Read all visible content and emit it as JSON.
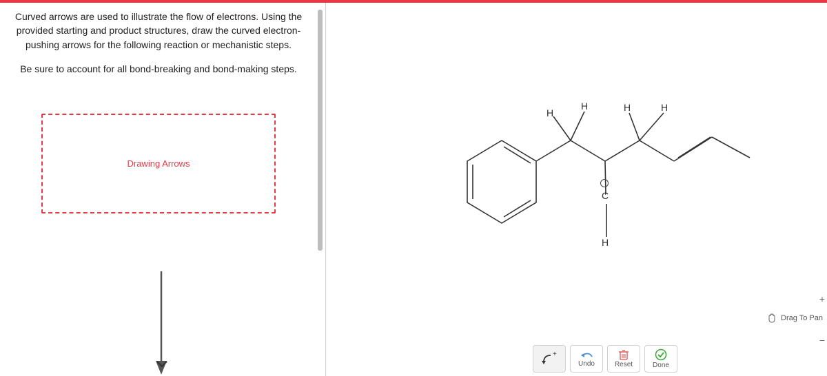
{
  "instructions": {
    "paragraph1": "Curved arrows are used to illustrate the flow of electrons. Using the provided starting and product structures, draw the curved electron-pushing arrows for the following reaction or mechanistic steps.",
    "paragraph2": "Be sure to account for all bond-breaking and bond-making steps."
  },
  "drawing_box_label": "Drawing Arrows",
  "molecule": {
    "labels": {
      "h1": "H",
      "h2": "H",
      "h3": "H",
      "h4": "H",
      "h5": "H",
      "c1": "C",
      "charge": "+"
    }
  },
  "toolbar": {
    "undo": "Undo",
    "reset": "Reset",
    "done": "Done"
  },
  "drag_to_pan": "Drag To Pan",
  "zoom": {
    "plus": "+",
    "minus": "−"
  }
}
